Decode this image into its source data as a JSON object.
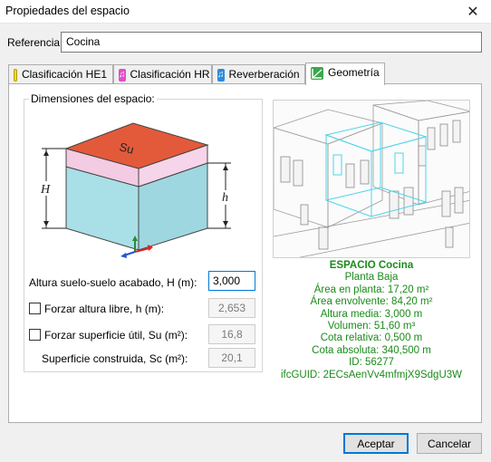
{
  "window": {
    "title": "Propiedades del espacio",
    "close_glyph": "✕"
  },
  "referencia": {
    "label": "Referencia:",
    "value": "Cocina"
  },
  "tabs": [
    {
      "label": "Clasificación HE1",
      "icon": "he1-icon",
      "color": "#f2d400"
    },
    {
      "label": "Clasificación HR",
      "icon": "hr-music-icon",
      "color": "#e040c8"
    },
    {
      "label": "Reverberación",
      "icon": "reverb-music-icon",
      "color": "#2e8bd8"
    },
    {
      "label": "Geometría",
      "icon": "geometry-icon",
      "color": "#3aa84a"
    }
  ],
  "dimensiones": {
    "title": "Dimensiones del espacio:",
    "cube_labels": {
      "su": "Su",
      "H": "H",
      "h": "h"
    },
    "altura_suelo": {
      "label": "Altura suelo-suelo acabado, H (m):",
      "value": "3,000"
    },
    "forzar_altura": {
      "label": "Forzar altura libre, h (m):",
      "value": "2,653",
      "checked": false
    },
    "forzar_superficie": {
      "label": "Forzar superficie útil, Su (m²):",
      "value": "16,8",
      "checked": false
    },
    "superficie_construida": {
      "label": "Superficie construida, Sc (m²):",
      "value": "20,1"
    }
  },
  "info": {
    "title": "ESPACIO Cocina",
    "lines": [
      "Planta Baja",
      "Área en planta: 17,20 m²",
      "Área envolvente: 84,20 m²",
      "Altura media: 3,000 m",
      "Volumen: 51,60 m³",
      "Cota relativa: 0,500 m",
      "Cota absoluta: 340,500 m",
      "ID: 56277",
      "ifcGUID: 2ECsAenVv4mfmjX9SdgU3W"
    ],
    "color": "#1a8a1a"
  },
  "buttons": {
    "accept": "Aceptar",
    "cancel": "Cancelar"
  }
}
